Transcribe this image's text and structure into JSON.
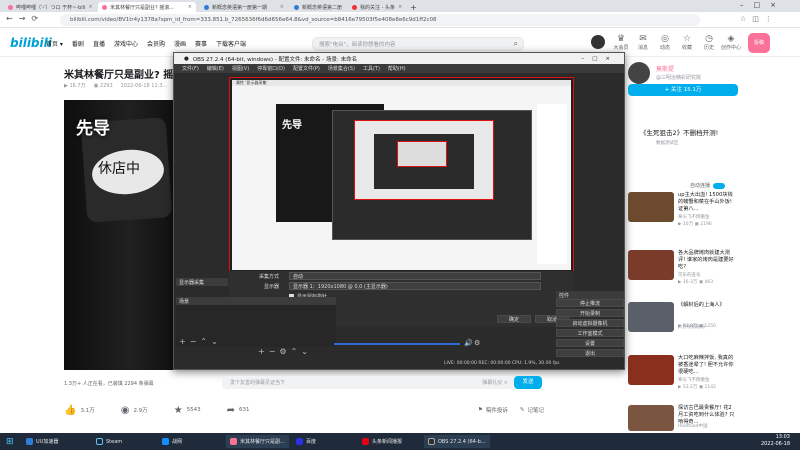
{
  "browser": {
    "tabs": [
      {
        "label": "哔哩哔哩（'-'）つロ 干杯~-bili"
      },
      {
        "label": "米其林餐厅只是副业? 摇滚..."
      },
      {
        "label": "新概念英语第一册第一期"
      },
      {
        "label": "新概念英语第二册"
      },
      {
        "label": "我的关注 - 头条"
      }
    ],
    "url": "bilibili.com/video/BV1tr4y1378a?spm_id_from=333.851.b_7265636f6d6d656e64.8&vd_source=b8416e79503f5e408e8e6c9d1ff2c08"
  },
  "bili": {
    "logo": "bilibili",
    "nav": [
      "首页 ▾",
      "番剧",
      "直播",
      "游戏中心",
      "会员购",
      "漫画",
      "赛事",
      "下载客户端"
    ],
    "search_placeholder": "搜索\"电台\"，阅读你想看的内容",
    "icons": [
      {
        "label": "大会员",
        "icon": "vip-icon"
      },
      {
        "label": "消息",
        "icon": "message-icon"
      },
      {
        "label": "动态",
        "icon": "dynamic-icon"
      },
      {
        "label": "收藏",
        "icon": "favorite-icon"
      },
      {
        "label": "历史",
        "icon": "history-icon"
      },
      {
        "label": "创作中心",
        "icon": "creator-icon"
      }
    ],
    "upload_label": "投稿",
    "video_title": "米其林餐厅只是副业? 摇滚...",
    "meta": {
      "views": "16.7万",
      "danmaku": "2293",
      "date": "2022-06-18 11:3..."
    },
    "subtitle_sign": "先导",
    "subtitle_shop": "休店中",
    "watchers": "1.3万+ 人正在看，已装填 2294 条弹幕",
    "danmaku_placeholder": "发个友善的弹幕见证当下",
    "danmaku_etiquette": "弹幕礼仪 >",
    "send_label": "发送",
    "actions": [
      {
        "icon": "like-icon",
        "label": "3.1万"
      },
      {
        "icon": "coin-icon",
        "label": "2.9万"
      },
      {
        "icon": "favorite-icon",
        "label": "5543"
      },
      {
        "icon": "share-icon",
        "label": "631"
      }
    ],
    "report_label": "稿件投诉",
    "note_label": "记笔记"
  },
  "sidebar": {
    "uploader_name": "莫斯提",
    "uploader_desc": "@三明治精彩研究院",
    "follow_label": "+ 关注 15.1万",
    "autoplay_label": "自动连播",
    "recs": [
      {
        "title": "《生死狙击2》不删档开测!",
        "user": "数据测试区"
      },
      {
        "title": "up主大出血! 1500块钱的螃蟹和菜在手山外饭! 证第八...",
        "user": "拳头飞不倒重鱼",
        "stats": "▶ 10万  ▣ 2196"
      },
      {
        "title": "各大品牌烤肉就建大测评! 谁家的烤肉是建要好吃?",
        "user": "可乐的查号",
        "stats": "▶ 16.3万  ▣ 463"
      },
      {
        "title": "《解封后的上海人》",
        "user": "大胖粉粉粉粉",
        "stats": "▶ 51.8万  ▣ 1250"
      },
      {
        "title": "大口吃麻辣拌饭, 我真的被香迷晕了! 胆不允许你很硬吃...",
        "user": "拳头飞不倒重鱼",
        "stats": "▶ 53.2万  ▣ 1142"
      },
      {
        "title": "探访古巴最贵餐厅! 花2月工资吃到什么体验? 只啃得奇...",
        "user": "Hooftood中国"
      }
    ]
  },
  "obs": {
    "title": "OBS 27.2.4 (64-bit, windows) - 配置文件: 未命名 - 场景: 未命名",
    "menu": [
      "文件(F)",
      "编辑(E)",
      "视图(V)",
      "停靠窗口(D)",
      "配置文件(P)",
      "场景集合(S)",
      "工具(T)",
      "帮助(H)"
    ],
    "dialog_title": "属性 '显示器采集'",
    "capture_method_label": "采集方式",
    "capture_method_value": "自动",
    "display_label": "显示器",
    "display_value": "显示器 1：1920x1080 @ 0,0 (主显示器)",
    "cursor_label": "显示鼠标指针",
    "scenes_header": "场景",
    "sources_header": "显示器采集",
    "defaults_button": "默认",
    "ok_button": "确定",
    "cancel_button": "取消",
    "controls_header": "控件",
    "controls": [
      "停止推流",
      "开始录制",
      "启动虚拟摄像机",
      "工作室模式",
      "设置",
      "退出"
    ],
    "status": "LIVE: 00:00:00   REC: 00:00:00   CPU: 1.9%, 30.00 fps"
  },
  "taskbar": {
    "items": [
      {
        "label": "UU加速器",
        "color": "#2e7dd7"
      },
      {
        "label": "Steam",
        "color": "#1b2838"
      },
      {
        "label": "战网",
        "color": "#148eff"
      },
      {
        "label": "米其林餐厅只是副...",
        "color": "#fb7299"
      },
      {
        "label": "百度",
        "color": "#2932e1"
      },
      {
        "label": "头条新闻播报",
        "color": "#e60012"
      },
      {
        "label": "OBS 27.2.4 (64-b...",
        "color": "#302e31"
      }
    ],
    "time": "13:03",
    "date": "2022-06-18"
  }
}
